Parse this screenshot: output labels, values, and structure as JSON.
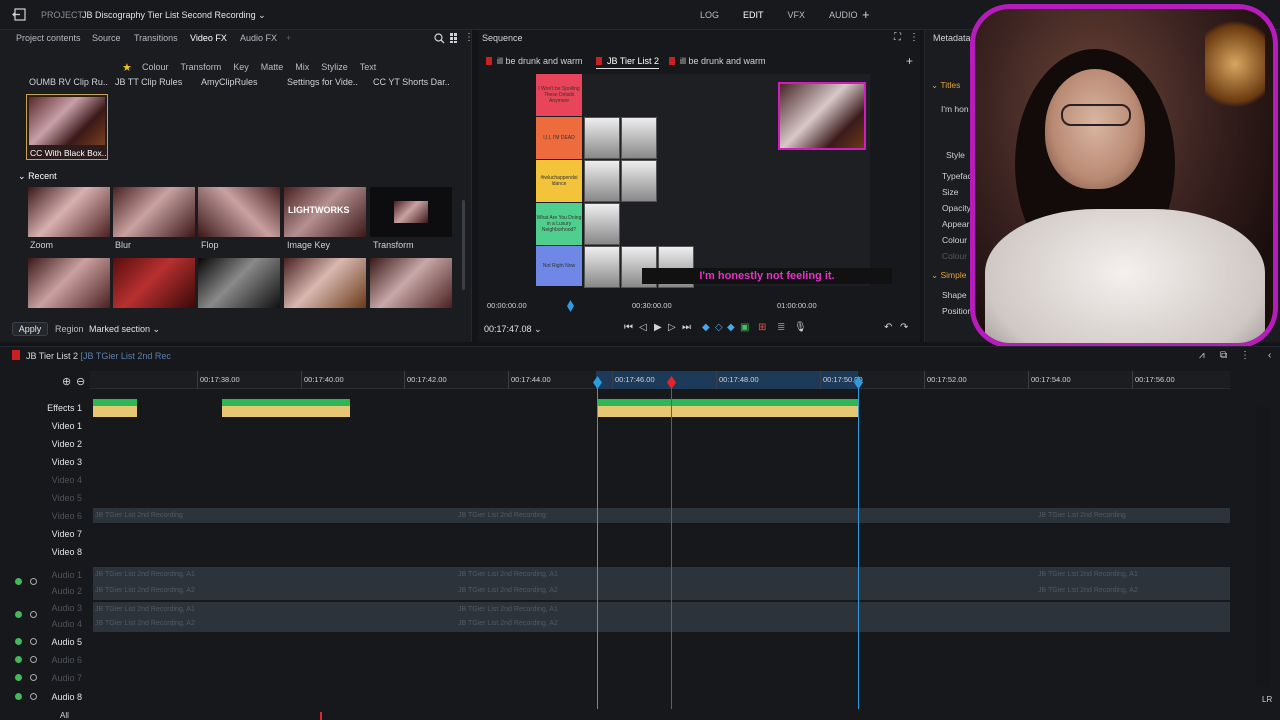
{
  "topbar": {
    "project_label": "PROJECT",
    "project_name": "JB Discography Tier List Second Recording",
    "modes": [
      "LOG",
      "EDIT",
      "VFX",
      "AUDIO"
    ],
    "active_mode": "EDIT",
    "add_label": "+"
  },
  "library": {
    "tabs": [
      "Project contents",
      "Source",
      "Transitions",
      "Video FX",
      "Audio FX"
    ],
    "active_tab": "Video FX",
    "subtabs": [
      "Colour",
      "Transform",
      "Key",
      "Matte",
      "Mix",
      "Stylize",
      "Text"
    ],
    "fx_names": [
      "OUMB RV Clip Ru..",
      "JB TT Clip Rules",
      "AmyClipRules",
      "Settings for Vide..",
      "CC YT Shorts Dar.."
    ],
    "selected_caption": "CC With Black Box..",
    "recent_header": "Recent",
    "recent": [
      "Zoom",
      "Blur",
      "Flop",
      "Image Key",
      "Transform"
    ],
    "lightworks_text": "LIGHTWORKS",
    "apply_label": "Apply",
    "region_label": "Region",
    "region_value": "Marked section"
  },
  "viewer": {
    "title": "Sequence",
    "tabs": [
      "ill be drunk and warm",
      "JB Tier List 2",
      "ill be drunk and warm"
    ],
    "active_tab": "JB Tier List 2",
    "tiers": [
      {
        "label": "I Won't be Spoiling These Details Anymore",
        "color": "#e8455a"
      },
      {
        "label": "I,I,I, I'M DEAD",
        "color": "#ee6b3d"
      },
      {
        "label": "#iwluchappendsi ldance",
        "color": "#f3c43a"
      },
      {
        "label": "What Are You Doing in a Luxury Neighborhood?",
        "color": "#4fcf8d"
      },
      {
        "label": "Not Right Now",
        "color": "#6f88e6"
      }
    ],
    "subtitle": "I'm honestly not feeling it.",
    "ruler": [
      "00:00:00.00",
      "00:30:00.00",
      "01:00:00.00"
    ],
    "timecode": "00:17:47.08"
  },
  "metadata": {
    "title": "Metadata",
    "titles_label": "Titles",
    "text_preview": "I'm hon",
    "style_label": "Style",
    "fields": [
      "Typefac",
      "Size",
      "Opacity",
      "Appear",
      "Colour",
      "Colour"
    ],
    "simple_label": "Simple",
    "shape_label": "Shape",
    "position_label": "Position"
  },
  "timeline": {
    "sequence_name": "JB Tier List 2",
    "sequence_sub": "[JB TGier List 2nd Rec",
    "ticks": [
      "00:17:38.00",
      "00:17:40.00",
      "00:17:42.00",
      "00:17:44.00",
      "00:17:46.00",
      "00:17:48.00",
      "00:17:50.00",
      "00:17:52.00",
      "00:17:54.00",
      "00:17:56.00"
    ],
    "tracks": [
      {
        "name": "Effects 1",
        "active": true
      },
      {
        "name": "Video 1",
        "active": true
      },
      {
        "name": "Video 2",
        "active": true
      },
      {
        "name": "Video 3",
        "active": true
      },
      {
        "name": "Video 4",
        "active": false
      },
      {
        "name": "Video 5",
        "active": false
      },
      {
        "name": "Video 6",
        "active": false
      },
      {
        "name": "Video 7",
        "active": true
      },
      {
        "name": "Video 8",
        "active": true
      },
      {
        "name": "Audio 1",
        "active": false
      },
      {
        "name": "Audio 2",
        "active": false
      },
      {
        "name": "Audio 3",
        "active": false
      },
      {
        "name": "Audio 4",
        "active": false
      },
      {
        "name": "Audio 5",
        "active": true
      },
      {
        "name": "Audio 6",
        "active": false
      },
      {
        "name": "Audio 7",
        "active": false
      },
      {
        "name": "Audio 8",
        "active": true
      }
    ],
    "video6_clip": "JB TGier List 2nd Recording",
    "audio_clip_a1": "JB TGier List 2nd Recording, A1",
    "audio_clip_a2": "JB TGier List 2nd Recording, A2",
    "all_label": "All",
    "lr_label": "LR"
  },
  "colors": {
    "accent": "#2d9be0",
    "playhead": "#e4262a",
    "webcam_border": "#b61bbb"
  }
}
